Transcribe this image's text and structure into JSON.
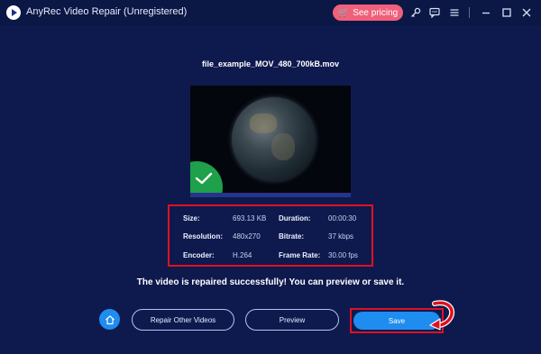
{
  "app": {
    "title": "AnyRec Video Repair (Unregistered)",
    "pricing_label": "See pricing"
  },
  "titlebar_icons": [
    "key-icon",
    "feedback-icon",
    "menu-icon",
    "minimize-icon",
    "maximize-icon",
    "close-icon"
  ],
  "video": {
    "filename": "file_example_MOV_480_700kB.mov"
  },
  "info": {
    "size_label": "Size:",
    "size_value": "693.13 KB",
    "duration_label": "Duration:",
    "duration_value": "00:00:30",
    "resolution_label": "Resolution:",
    "resolution_value": "480x270",
    "bitrate_label": "Bitrate:",
    "bitrate_value": "37 kbps",
    "encoder_label": "Encoder:",
    "encoder_value": "H.264",
    "framerate_label": "Frame Rate:",
    "framerate_value": "30.00 fps"
  },
  "message": "The video is repaired successfully! You can preview or save it.",
  "actions": {
    "repair_other_label": "Repair Other Videos",
    "preview_label": "Preview",
    "save_label": "Save"
  },
  "colors": {
    "background": "#0e1a4e",
    "accent_blue": "#1f8cf0",
    "pricing_pink": "#f0607a",
    "highlight_red": "#e01020",
    "success_green": "#1fa04a"
  }
}
